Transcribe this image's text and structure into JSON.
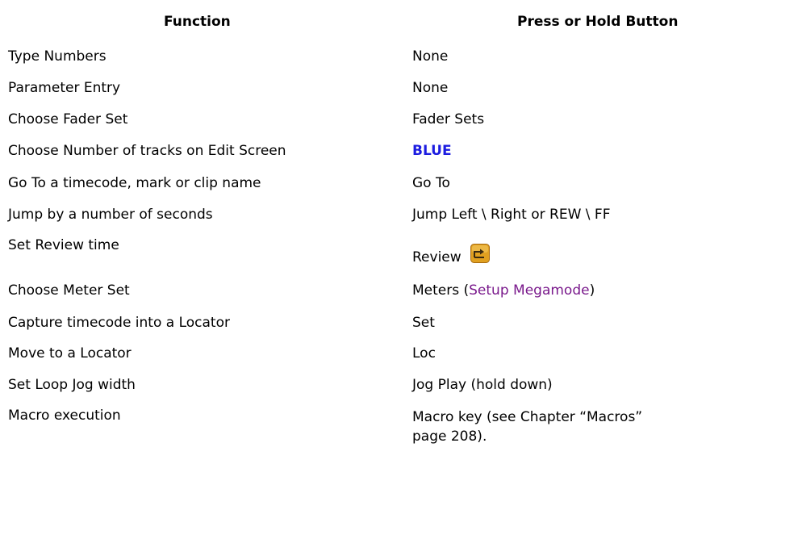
{
  "header": {
    "function": "Function",
    "button": "Press or Hold Button"
  },
  "rows": [
    {
      "function": "Type Numbers",
      "button": "None"
    },
    {
      "function": "Parameter Entry",
      "button": "None"
    },
    {
      "function": "Choose Fader Set",
      "button": "Fader Sets"
    },
    {
      "function": "Choose Number of tracks on Edit Screen",
      "button": "BLUE"
    },
    {
      "function": "Go To a timecode, mark or clip name",
      "button": "Go To"
    },
    {
      "function": "Jump by a number of seconds",
      "button": "Jump Left \\ Right or REW \\ FF"
    },
    {
      "function": "Set Review time",
      "button": "Review"
    },
    {
      "function": "Choose Meter Set",
      "button_prefix": "Meters (",
      "button_link": "Setup Megamode",
      "button_suffix": ")"
    },
    {
      "function": "Capture timecode into a Locator",
      "button": "Set"
    },
    {
      "function": "Move to a Locator",
      "button": "Loc"
    },
    {
      "function": "Set Loop Jog width",
      "button": "Jog Play (hold down)"
    },
    {
      "function": "Macro execution",
      "button": "Macro key (see Chapter “Macros” page 208)."
    }
  ],
  "colors": {
    "blue_key": "#1c1ce0",
    "link": "#7a1a8c",
    "review_icon": "#e0a020"
  },
  "icons": {
    "review": "review-button-icon"
  }
}
